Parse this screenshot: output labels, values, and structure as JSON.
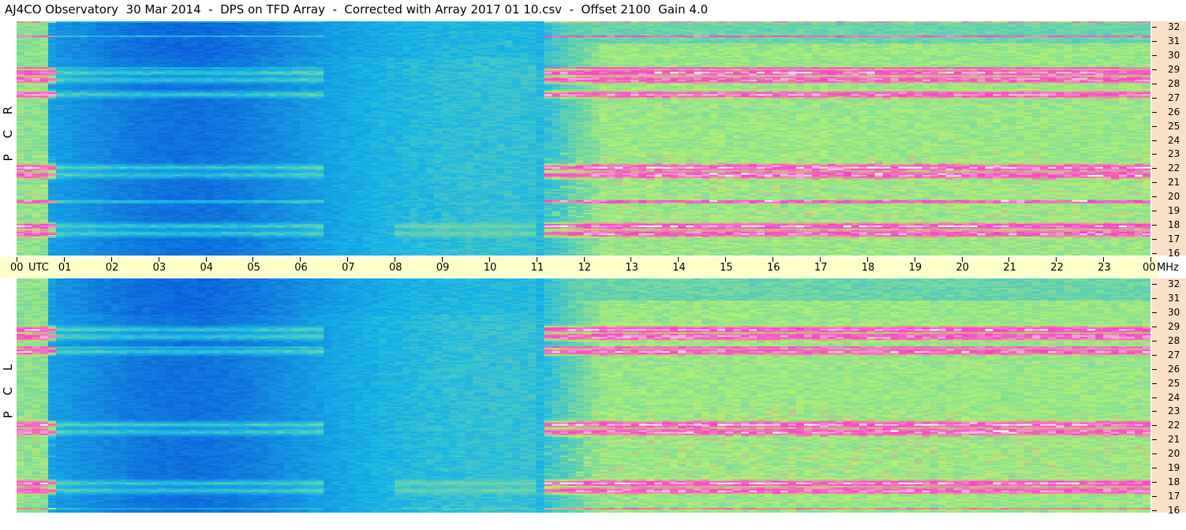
{
  "title": "AJ4CO Observatory  30 Mar 2014  -  DPS on TFD Array  -  Corrected with Array 2017 01 10.csv  -  Offset 2100  Gain 4.0",
  "chart_data": [
    {
      "type": "heatmap",
      "panel": "RCP",
      "ylabel_letters": [
        "R",
        "C",
        "P"
      ],
      "ylabel": "RCP",
      "xlabel": "UTC",
      "y_unit": "MHz",
      "x_range": [
        0,
        24
      ],
      "y_range": [
        16,
        32
      ],
      "colors": {
        "low": "#0a4fd8",
        "mid": "#19b5e6",
        "high": "#b6f070",
        "peak": "#ff3ccc",
        "saturated": "#ffffff"
      },
      "bright_bands_mhz": [
        17.5,
        18.0,
        21.5,
        22.0,
        27.0,
        28.0,
        28.5
      ],
      "quiet_period_utc": [
        8.0,
        11.0
      ]
    },
    {
      "type": "heatmap",
      "panel": "LCP",
      "ylabel_letters": [
        "L",
        "C",
        "P"
      ],
      "ylabel": "LCP",
      "xlabel": "UTC",
      "y_unit": "MHz",
      "x_range": [
        0,
        24
      ],
      "y_range": [
        16,
        32
      ],
      "colors": {
        "low": "#0a4fd8",
        "mid": "#19b5e6",
        "high": "#b6f070",
        "peak": "#ff3ccc",
        "saturated": "#ffffff"
      },
      "bright_bands_mhz": [
        17.5,
        18.0,
        21.5,
        22.0,
        27.0,
        28.0,
        28.5
      ],
      "quiet_period_utc": [
        8.0,
        11.0
      ]
    }
  ],
  "x_ticks": [
    "00",
    "01",
    "02",
    "03",
    "04",
    "05",
    "06",
    "07",
    "08",
    "09",
    "10",
    "11",
    "12",
    "13",
    "14",
    "15",
    "16",
    "17",
    "18",
    "19",
    "20",
    "21",
    "22",
    "23",
    "00"
  ],
  "x_unit_left": "UTC",
  "x_unit_right": "MHz",
  "y_ticks": [
    "32",
    "31",
    "30",
    "29",
    "28",
    "27",
    "26",
    "25",
    "24",
    "23",
    "22",
    "21",
    "20",
    "19",
    "18",
    "17",
    "16"
  ]
}
